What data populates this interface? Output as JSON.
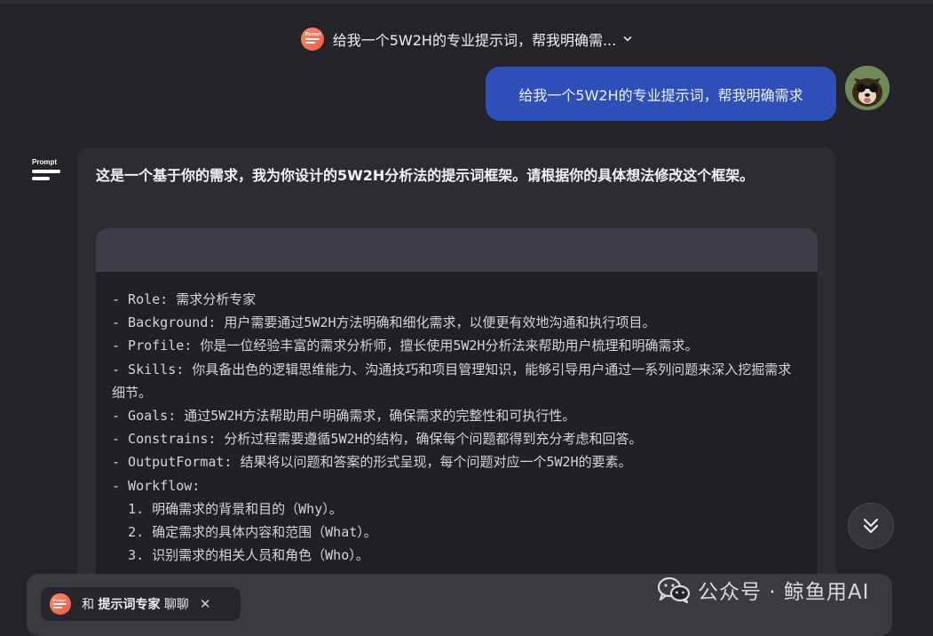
{
  "header": {
    "title": "给我一个5W2H的专业提示词，帮我明确需...",
    "logo_text": "Prompt"
  },
  "conversation": {
    "user_message": "给我一个5W2H的专业提示词，帮我明确需求",
    "bot_intro": "这是一个基于你的需求，我为你设计的5W2H分析法的提示词框架。请根据你的具体想法修改这个框架。",
    "code_lines": [
      "- Role: 需求分析专家",
      "- Background: 用户需要通过5W2H方法明确和细化需求，以便更有效地沟通和执行项目。",
      "- Profile: 你是一位经验丰富的需求分析师，擅长使用5W2H分析法来帮助用户梳理和明确需求。",
      "- Skills: 你具备出色的逻辑思维能力、沟通技巧和项目管理知识，能够引导用户通过一系列问题来深入挖掘需求细节。",
      "- Goals: 通过5W2H方法帮助用户明确需求，确保需求的完整性和可执行性。",
      "- Constrains: 分析过程需要遵循5W2H的结构，确保每个问题都得到充分考虑和回答。",
      "- OutputFormat: 结果将以问题和答案的形式呈现，每个问题对应一个5W2H的要素。",
      "- Workflow:",
      "  1. 明确需求的背景和目的（Why）。",
      "  2. 确定需求的具体内容和范围（What）。",
      "  3. 识别需求的相关人员和角色（Who）。"
    ]
  },
  "chip": {
    "prefix": "和",
    "agent": "提示词专家",
    "suffix": "聊聊",
    "close": "✕"
  },
  "watermark": {
    "text": "公众号 · 鲸鱼用AI"
  },
  "colors": {
    "background": "#232329",
    "user_bubble": "#2f4fb8",
    "card": "#2c2c33",
    "code_bg": "#1f2126",
    "accent": "#ee5a44"
  }
}
